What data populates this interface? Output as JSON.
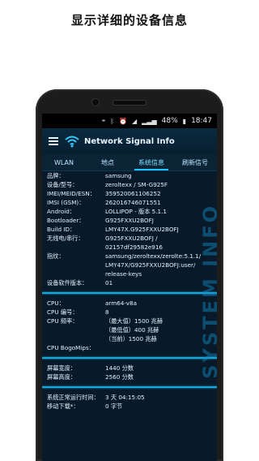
{
  "headline": "显示详细的设备信息",
  "status_bar": {
    "battery": "48%",
    "time": "18:47"
  },
  "app": {
    "title": "Network Signal Info"
  },
  "tabs": [
    {
      "label": "WLAN",
      "active": false
    },
    {
      "label": "地点",
      "active": false
    },
    {
      "label": "系统信息",
      "active": true
    },
    {
      "label": "刷新信号",
      "active": false
    }
  ],
  "watermark": "SYSTEM INFO",
  "device_info": [
    {
      "k": "品牌：",
      "v": "samsung"
    },
    {
      "k": "设备/型号：",
      "v": "zeroltexx / SM-G925F"
    },
    {
      "k": "IMEI/MEID/ESN：",
      "v": "359520061106252"
    },
    {
      "k": "IMSI (GSM)：",
      "v": "262016746071551"
    },
    {
      "k": "Android：",
      "v": "LOLLIPOP - 版本 5.1.1"
    },
    {
      "k": "Bootloader：",
      "v": "G925FXXU2BOFJ"
    },
    {
      "k": "Build ID：",
      "v": "LMY47X.G925FXXU2BOFJ"
    },
    {
      "k": "无线电/串行：",
      "v": "G925FXXU2BOFJ / 02157df29582e916"
    },
    {
      "k": "指纹：",
      "v": "samsung/zeroltexx/zerolte:5.1.1/ LMY47X/G925FXXU2BOFJ:user/ release-keys"
    },
    {
      "k": "设备软件版本：",
      "v": "01"
    }
  ],
  "cpu_info": [
    {
      "k": "CPU：",
      "v": "arm64-v8a"
    },
    {
      "k": "CPU 编号：",
      "v": "8"
    },
    {
      "k": "CPU 频率：",
      "v": "（最大值）1500 兆赫"
    },
    {
      "k": "",
      "v": "（最低值）400 兆赫"
    },
    {
      "k": "",
      "v": "（当前）1500 兆赫"
    },
    {
      "k": "CPU BogoMips：",
      "v": ""
    }
  ],
  "screen_info": [
    {
      "k": "屏幕宽度：",
      "v": "1440 分数"
    },
    {
      "k": "屏幕高度：",
      "v": "2560 分数"
    }
  ],
  "uptime_info": [
    {
      "k": "系统正常运行时间：",
      "v": "3 天 04:15:05"
    },
    {
      "k": "移动下载*：",
      "v": "0 字节"
    }
  ]
}
